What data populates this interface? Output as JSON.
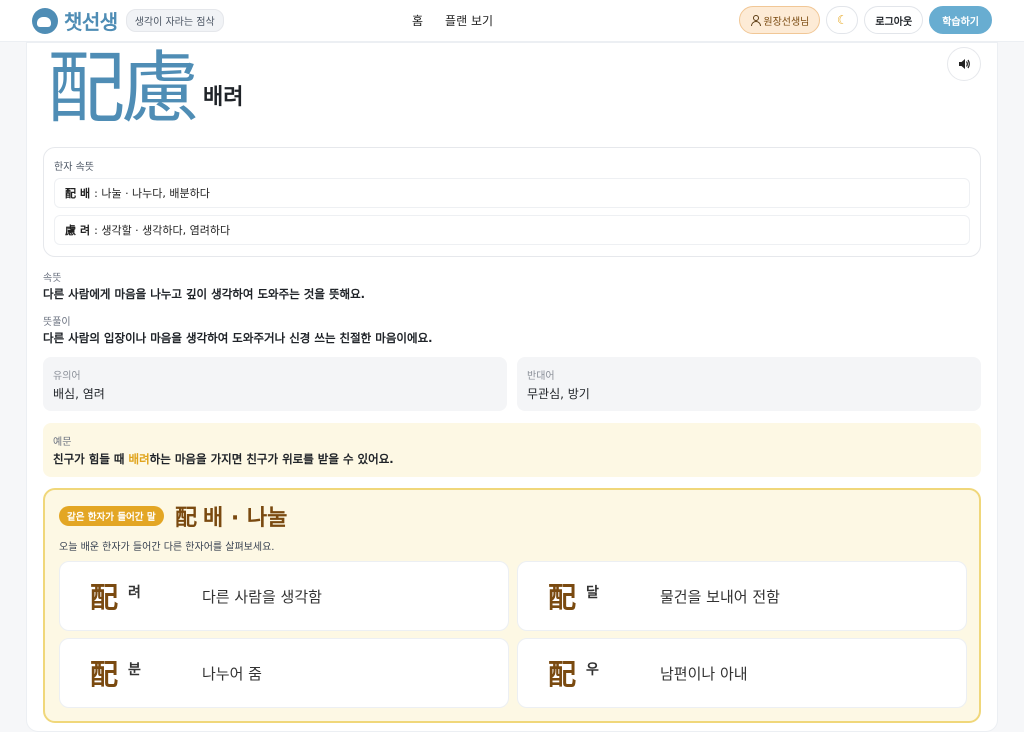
{
  "header": {
    "brand_name": "챗선생",
    "brand_tag": "생각이 자라는 점삭",
    "nav": [
      "홈",
      "플랜 보기"
    ],
    "role_badge": "원장선생님",
    "theme_toggle_icon": "moon-icon",
    "logout_label": "로그아웃",
    "study_label": "학습하기"
  },
  "word": {
    "hanja": "配慮",
    "reading": "배려",
    "speaker_icon": "speaker-icon"
  },
  "hanja_meanings": {
    "title": "한자 속뜻",
    "items": [
      {
        "char": "配",
        "reading": "배",
        "meaning": ": 나눌 · 나누다, 배분하다"
      },
      {
        "char": "慮",
        "reading": "려",
        "meaning": ": 생각할 · 생각하다, 염려하다"
      }
    ]
  },
  "sokttut": {
    "label": "속뜻",
    "text": "다른 사람에게 마음을 나누고 깊이 생각하여 도와주는 것을 뜻해요."
  },
  "ttutpuri": {
    "label": "뜻풀이",
    "text": "다른 사람의 입장이나 마음을 생각하여 도와주거나 신경 쓰는 친절한 마음이에요."
  },
  "synonym": {
    "label": "유의어",
    "value": "배심, 염려"
  },
  "antonym": {
    "label": "반대어",
    "value": "무관심, 방기"
  },
  "example": {
    "label": "예문",
    "before": "친구가 힘들 때 ",
    "highlight": "배려",
    "after": "하는 마음을 가지면 친구가 위로를 받을 수 있어요."
  },
  "related": {
    "badge": "같은 한자가 들어간 말",
    "title_char": "配",
    "title_reading": "배 · 나눌",
    "subtitle": "오늘 배운 한자가 들어간 다른 한자어를 살펴보세요.",
    "cards": [
      {
        "char": "配",
        "rest": "려",
        "meaning": "다른 사람을 생각함"
      },
      {
        "char": "配",
        "rest": "달",
        "meaning": "물건을 보내어 전함"
      },
      {
        "char": "配",
        "rest": "분",
        "meaning": "나누어 줌"
      },
      {
        "char": "配",
        "rest": "우",
        "meaning": "남편이나 아내"
      }
    ]
  },
  "colors": {
    "brand": "#4f8db5",
    "study_button": "#68add1",
    "related_accent": "#e3a624",
    "related_text": "#7a4a10"
  }
}
